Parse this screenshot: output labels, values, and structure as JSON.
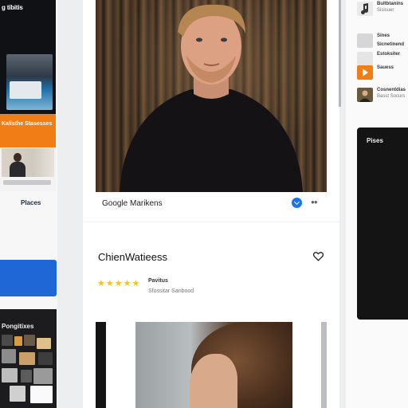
{
  "left_panel": {
    "top_label": "g tibitis",
    "orange_text": "Kalisthe Stasesses",
    "places_label": "Places",
    "dark_label": "Pongitixes"
  },
  "hero": {
    "caption": "Google Marikens"
  },
  "listing": {
    "title": "ChienWatieess",
    "rating_label": "Pavitus",
    "rating_subtext": "Sfossitar Sanbood",
    "stars": 5
  },
  "right_panel": {
    "items": [
      {
        "title": "Bultbtanins",
        "subtitle": "Sisisuer",
        "icon": "music-note-icon",
        "color": "#e9e9ea"
      },
      {
        "title": "Sines",
        "subtitle": "",
        "icon": "image-icon",
        "color": "#d6d6d8"
      },
      {
        "title": "Sicnetinend",
        "subtitle": "",
        "icon": "image-icon",
        "color": "#cfcfd1"
      },
      {
        "title": "Estoksiter",
        "subtitle": "",
        "icon": "image-icon",
        "color": "#e5e5e6"
      },
      {
        "title": "Sauess",
        "subtitle": "",
        "icon": "play-icon",
        "color": "#f07d16"
      },
      {
        "title": "Cosnentdias",
        "subtitle": "Basst Socurs",
        "icon": "avatar-icon",
        "color": "#6a5a3c"
      }
    ],
    "places_label": "Pises"
  },
  "colors": {
    "accent_blue": "#1f66d6",
    "accent_orange": "#f07d16",
    "star_yellow": "#f6c21c"
  }
}
